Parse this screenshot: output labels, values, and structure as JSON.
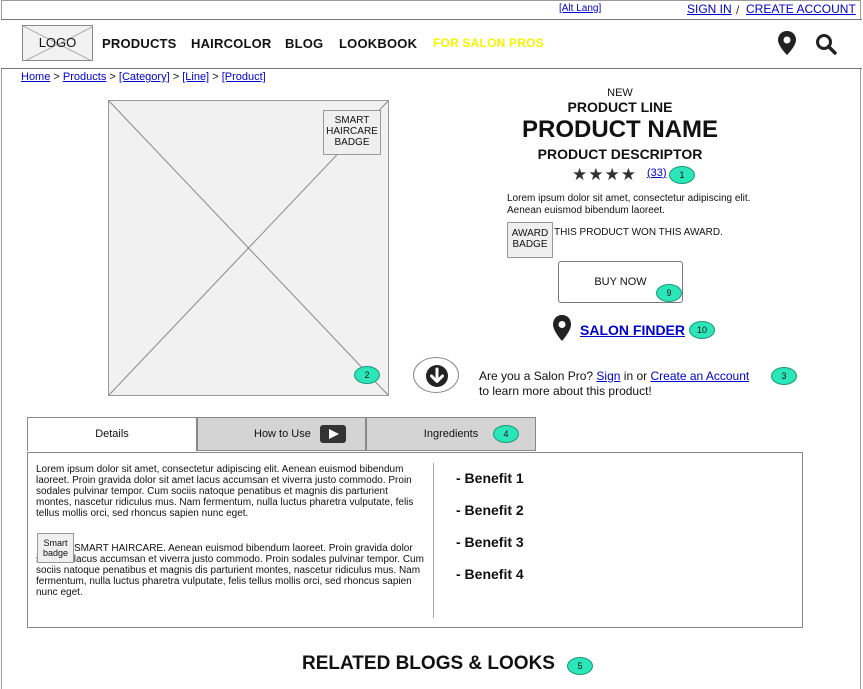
{
  "util_bar": {
    "alt_lang": "[Alt Lang]",
    "sign_in": "SIGN IN",
    "separator": "/",
    "create_account": "CREATE ACCOUNT"
  },
  "header": {
    "logo": "LOGO",
    "nav": [
      "PRODUCTS",
      "HAIRCOLOR",
      "BLOG",
      "LOOKBOOK",
      "FOR SALON PROS"
    ],
    "icons": [
      "location-pin-icon",
      "search-icon"
    ]
  },
  "breadcrumb": {
    "items": [
      "Home",
      "Products",
      "[Category]",
      "[Line]",
      "[Product]"
    ],
    "separator": ">"
  },
  "product_image": {
    "badge": "SMART HAIRCARE BADGE"
  },
  "product": {
    "eyebrow": "NEW",
    "line": "PRODUCT LINE",
    "name": "PRODUCT NAME",
    "descriptor": "PRODUCT DESCRIPTOR",
    "rating_stars": 4,
    "review_count": "(33)",
    "description": "Lorem ipsum dolor sit amet, consectetur adipiscing elit. Aenean euismod bibendum laoreet.",
    "award_badge": "AWARD BADGE",
    "award_text": "THIS PRODUCT WON THIS AWARD.",
    "buy_now": "BUY NOW",
    "salon_finder": "SALON FINDER"
  },
  "salon_pro": {
    "prefix": "Are you a Salon Pro?",
    "sign_in": "Sign",
    "middle": "in or",
    "create": "Create an Account",
    "suffix": "to learn more about this product!"
  },
  "tabs": [
    {
      "label": "Details"
    },
    {
      "label": "How to Use"
    },
    {
      "label": "Ingredients"
    }
  ],
  "details": {
    "paragraph1": "Lorem ipsum dolor sit amet, consectetur adipiscing elit. Aenean euismod bibendum laoreet. Proin gravida dolor sit amet lacus accumsan et viverra justo commodo. Proin sodales pulvinar tempor. Cum sociis natoque penatibus et magnis dis parturient montes, nascetur ridiculus mus. Nam fermentum, nulla luctus pharetra vulputate, felis tellus mollis orci, sed rhoncus sapien nunc eget.",
    "badge": "Smart badge",
    "paragraph2": "SMART HAIRCARE. Aenean euismod bibendum laoreet. Proin gravida dolor sit amet lacus accumsan et viverra justo commodo. Proin sodales pulvinar tempor. Cum sociis natoque penatibus et magnis dis parturient montes, nascetur ridiculus mus. Nam fermentum, nulla luctus pharetra vulputate, felis tellus mollis orci, sed rhoncus sapien nunc eget.",
    "benefits": [
      "- Benefit 1",
      "- Benefit 2",
      "- Benefit 3",
      "- Benefit 4"
    ]
  },
  "related": {
    "title": "RELATED BLOGS & LOOKS"
  },
  "annotations": [
    "1",
    "2",
    "3",
    "4",
    "5",
    "9",
    "10"
  ],
  "colors": {
    "link": "#0000cc",
    "salon_pros_nav": "#f5f500",
    "annotation": "#2be6b8",
    "tab_inactive": "#d4d4d4"
  }
}
